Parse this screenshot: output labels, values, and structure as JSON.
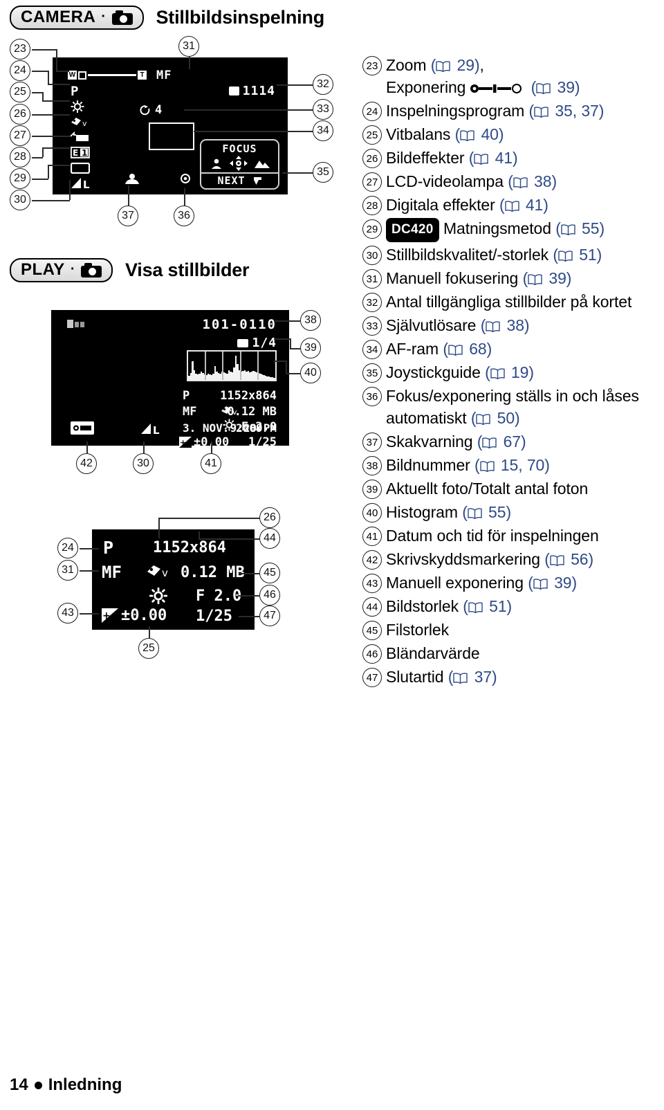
{
  "page": {
    "footer_number": "14",
    "footer_label": "Inledning",
    "ref_color": "#2e4a87"
  },
  "camera_section": {
    "badge_label": "CAMERA",
    "badge_separator": "·",
    "badge_icon": "camera-icon",
    "title": "Stillbildsinspelning",
    "screen": {
      "zoom_w": "W",
      "zoom_t": "T",
      "program": "P",
      "manual_focus": "MF",
      "card_count": "1114",
      "self_timer_value": "4",
      "quality": "L",
      "digital_effect": "E1",
      "joystick_focus": "FOCUS",
      "joystick_next": "NEXT"
    },
    "markers_left": [
      "23",
      "24",
      "25",
      "26",
      "27",
      "28",
      "29",
      "30"
    ],
    "markers_right": [
      "32",
      "33",
      "34",
      "35"
    ],
    "marker_top": "31",
    "markers_bottom": [
      "37",
      "36"
    ]
  },
  "play_section": {
    "badge_label": "PLAY",
    "badge_separator": "·",
    "badge_icon": "camera-icon",
    "title": "Visa stillbilder",
    "screen": {
      "image_number": "101-0110",
      "photo_index": "1/4",
      "program": "P",
      "image_size": "1152x864",
      "manual_focus": "MF",
      "file_size": "0.12 MB",
      "aperture": "F 2.0",
      "exposure_comp": "±0.00",
      "shutter": "1/25",
      "quality": "L",
      "date": "3. NOV. 2009",
      "time": "9:20 PM"
    },
    "markers_right": [
      "38",
      "39",
      "40"
    ],
    "markers_bottom": [
      "42",
      "30",
      "41"
    ]
  },
  "detail_section": {
    "screen": {
      "program": "P",
      "image_size": "1152x864",
      "manual_focus": "MF",
      "file_size": "0.12 MB",
      "aperture": "F 2.0",
      "exposure_comp": "±0.00",
      "shutter": "1/25"
    },
    "markers_left": [
      "24",
      "31",
      "43"
    ],
    "markers_right": [
      "26",
      "44",
      "45",
      "46",
      "47"
    ],
    "marker_bottom": "25"
  },
  "legend": [
    {
      "num": "23",
      "label": "Zoom",
      "ref": "29",
      "suffix": ",",
      "line2_label": "Exponering",
      "line2_icon": "exposure-slider-icon",
      "line2_ref": "39"
    },
    {
      "num": "24",
      "label": "Inspelningsprogram",
      "ref": "35, 37"
    },
    {
      "num": "25",
      "label": "Vitbalans",
      "ref": "40"
    },
    {
      "num": "26",
      "label": "Bildeffekter",
      "ref": "41"
    },
    {
      "num": "27",
      "label": "LCD-videolampa",
      "ref": "38"
    },
    {
      "num": "28",
      "label": "Digitala effekter",
      "ref": "41"
    },
    {
      "num": "29",
      "badge": "DC420",
      "label": "Matningsmetod",
      "ref": "55"
    },
    {
      "num": "30",
      "label": "Stillbildskvalitet/-storlek",
      "ref": "51"
    },
    {
      "num": "31",
      "label": "Manuell fokusering",
      "ref": "39"
    },
    {
      "num": "32",
      "label": "Antal tillgängliga stillbilder på kortet"
    },
    {
      "num": "33",
      "label": "Självutlösare",
      "ref": "38"
    },
    {
      "num": "34",
      "label": "AF-ram",
      "ref": "68"
    },
    {
      "num": "35",
      "label": "Joystickguide",
      "ref": "19"
    },
    {
      "num": "36",
      "label": "Fokus/exponering ställs in och låses",
      "line2_label": "automatiskt",
      "line2_ref": "50"
    },
    {
      "num": "37",
      "label": "Skakvarning",
      "ref": "67"
    },
    {
      "num": "38",
      "label": "Bildnummer",
      "ref": "15, 70"
    },
    {
      "num": "39",
      "label": "Aktuellt foto/Totalt antal foton"
    },
    {
      "num": "40",
      "label": "Histogram",
      "ref": "55"
    },
    {
      "num": "41",
      "label": "Datum och tid för inspelningen"
    },
    {
      "num": "42",
      "label": "Skrivskyddsmarkering",
      "ref": "56"
    },
    {
      "num": "43",
      "label": "Manuell exponering",
      "ref": "39"
    },
    {
      "num": "44",
      "label": "Bildstorlek",
      "ref": "51"
    },
    {
      "num": "45",
      "label": "Filstorlek"
    },
    {
      "num": "46",
      "label": "Bländarvärde"
    },
    {
      "num": "47",
      "label": "Slutartid",
      "ref": "37"
    }
  ],
  "chart_data": {
    "type": "bar",
    "title": "Histogram",
    "values": [
      6,
      10,
      26,
      14,
      9,
      8,
      9,
      12,
      10,
      8,
      7,
      9,
      8,
      7,
      9,
      20,
      12,
      10,
      9,
      12,
      11,
      10,
      9,
      14,
      12,
      11,
      18,
      34,
      22,
      14,
      12,
      13,
      14,
      12,
      13,
      11,
      12,
      13,
      12,
      11,
      10,
      9,
      8,
      7,
      6,
      5,
      5,
      4,
      4,
      3
    ],
    "divisions": 5,
    "ylim": [
      0,
      40
    ],
    "grid": true
  }
}
